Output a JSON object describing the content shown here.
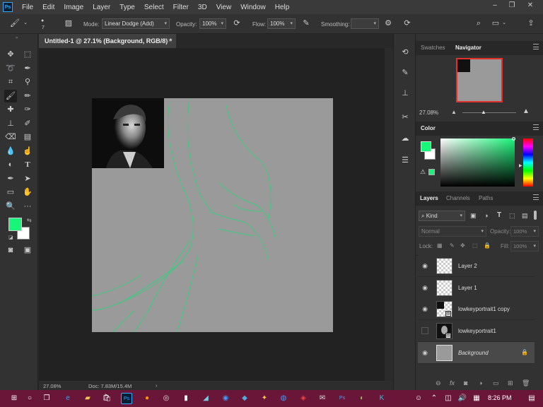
{
  "app": {
    "logo": "Ps"
  },
  "menu": [
    "File",
    "Edit",
    "Image",
    "Layer",
    "Type",
    "Select",
    "Filter",
    "3D",
    "View",
    "Window",
    "Help"
  ],
  "options": {
    "brush_size": "7",
    "mode_label": "Mode:",
    "mode_value": "Linear Dodge (Add)",
    "opacity_label": "Opacity:",
    "opacity_value": "100%",
    "flow_label": "Flow:",
    "flow_value": "100%",
    "smoothing_label": "Smoothing:",
    "smoothing_value": ""
  },
  "document": {
    "tab_title": "Untitled-1 @ 27.1% (Background, RGB/8) *",
    "close": "×"
  },
  "status": {
    "zoom": "27.08%",
    "doc_info": "Doc: 7.83M/15.4M",
    "arrow": "›"
  },
  "navigator": {
    "tabs": [
      "Swatches",
      "Navigator"
    ],
    "zoom": "27.08%"
  },
  "color_panel": {
    "title": "Color",
    "foreground": "#19f579",
    "background": "#ffffff"
  },
  "layers_panel": {
    "tabs": [
      "Layers",
      "Channels",
      "Paths"
    ],
    "filter_kind": "Kind",
    "blend_mode": "Normal",
    "opacity_label": "Opacity:",
    "opacity_value": "100%",
    "lock_label": "Lock:",
    "fill_label": "Fill:",
    "fill_value": "100%",
    "layers": [
      {
        "name": "Layer 2",
        "visible": true
      },
      {
        "name": "Layer 1",
        "visible": true
      },
      {
        "name": "lowkeyportrait1 copy",
        "visible": true
      },
      {
        "name": "lowkeyportrait1",
        "visible": false
      },
      {
        "name": "Background",
        "visible": true
      }
    ]
  },
  "taskbar": {
    "time": "8:26 PM"
  },
  "colors": {
    "accent_green": "#19f579",
    "taskbar": "#6a1638",
    "ps_blue": "#31a8ff"
  }
}
